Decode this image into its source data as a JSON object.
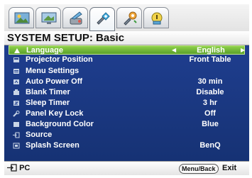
{
  "title": "SYSTEM SETUP: Basic",
  "tabs": [
    {
      "icon": "picture-icon"
    },
    {
      "icon": "display-icon"
    },
    {
      "icon": "setup-tools-icon"
    },
    {
      "icon": "system-setup-basic-icon",
      "active": true
    },
    {
      "icon": "system-setup-advanced-icon"
    },
    {
      "icon": "information-icon"
    }
  ],
  "menu": {
    "items": [
      {
        "label": "Language",
        "value": "English",
        "icon": "language-icon",
        "selected": true
      },
      {
        "label": "Projector Position",
        "value": "Front Table",
        "icon": "projector-position-icon"
      },
      {
        "label": "Menu Settings",
        "value": "",
        "icon": "menu-settings-icon"
      },
      {
        "label": "Auto Power Off",
        "value": "30 min",
        "icon": "auto-power-off-icon"
      },
      {
        "label": "Blank Timer",
        "value": "Disable",
        "icon": "blank-timer-icon"
      },
      {
        "label": "Sleep Timer",
        "value": "3 hr",
        "icon": "sleep-timer-icon"
      },
      {
        "label": "Panel Key Lock",
        "value": "Off",
        "icon": "panel-key-lock-icon"
      },
      {
        "label": "Background Color",
        "value": "Blue",
        "icon": "background-color-icon"
      },
      {
        "label": "Source",
        "value": "",
        "icon": "source-icon"
      },
      {
        "label": "Splash Screen",
        "value": "BenQ",
        "icon": "splash-screen-icon"
      }
    ]
  },
  "footer": {
    "source_label": "PC",
    "source_icon": "input-source-icon",
    "menu_back_label": "Menu/Back",
    "exit_label": "Exit"
  },
  "colors": {
    "panel": "#1f3e8f",
    "highlight": "#7cc23c",
    "text": "#ffffff"
  }
}
